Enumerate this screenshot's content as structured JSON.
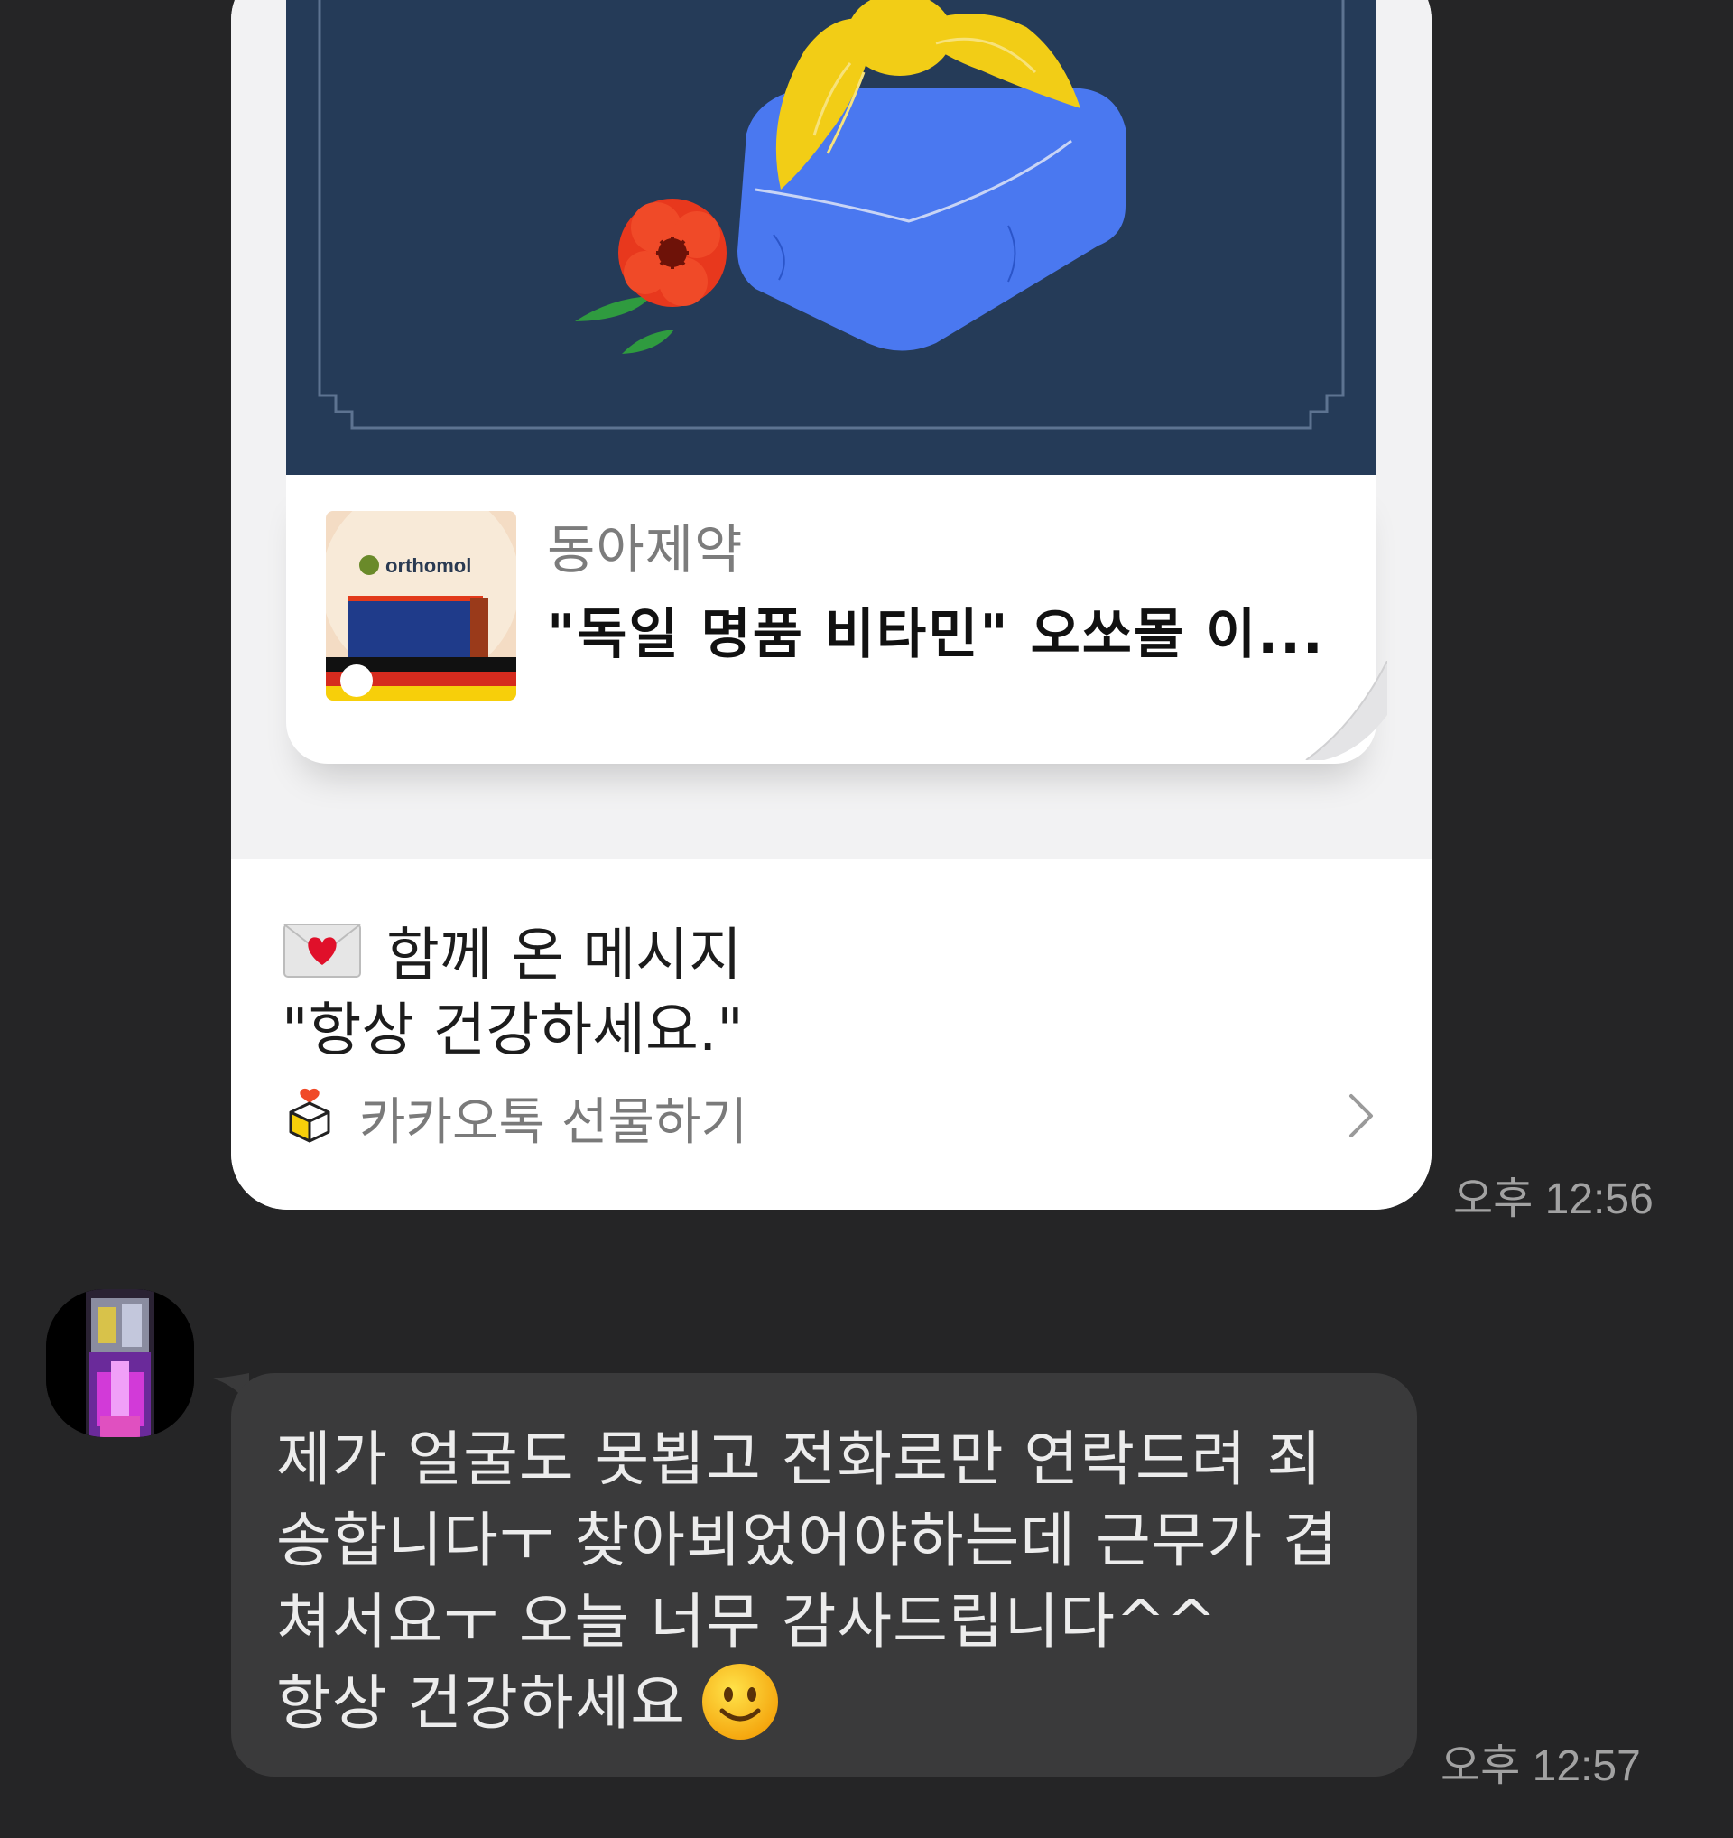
{
  "gift_card": {
    "brand": "동아제약",
    "product_title": "\"독일 명품 비타민\" 오쏘몰 이...",
    "product_thumb_text": "orthomol",
    "message_heading": "함께 온 메시지",
    "message_body": "\"항상 건강하세요.\"",
    "footer_label": "카카오톡 선물하기",
    "timestamp": "오후 12:56"
  },
  "incoming_message": {
    "lines": [
      "제가 얼굴도 못뵙고 전화로만 연락드려 죄",
      "송합니다ㅜ 찾아뵈었어야하는데 근무가 겹",
      "쳐서요ㅜ 오늘 너무 감사드립니다^^",
      "항상 건강하세요"
    ],
    "emoji": "smiling-face",
    "timestamp": "오후 12:57"
  },
  "colors": {
    "background": "#252526",
    "card": "#ffffff",
    "banner": "#253b58",
    "bubble": "#3a3a3b",
    "bojagi_blue": "#4a78f0",
    "bojagi_knot": "#f2cd16",
    "flower": "#e8381d"
  }
}
